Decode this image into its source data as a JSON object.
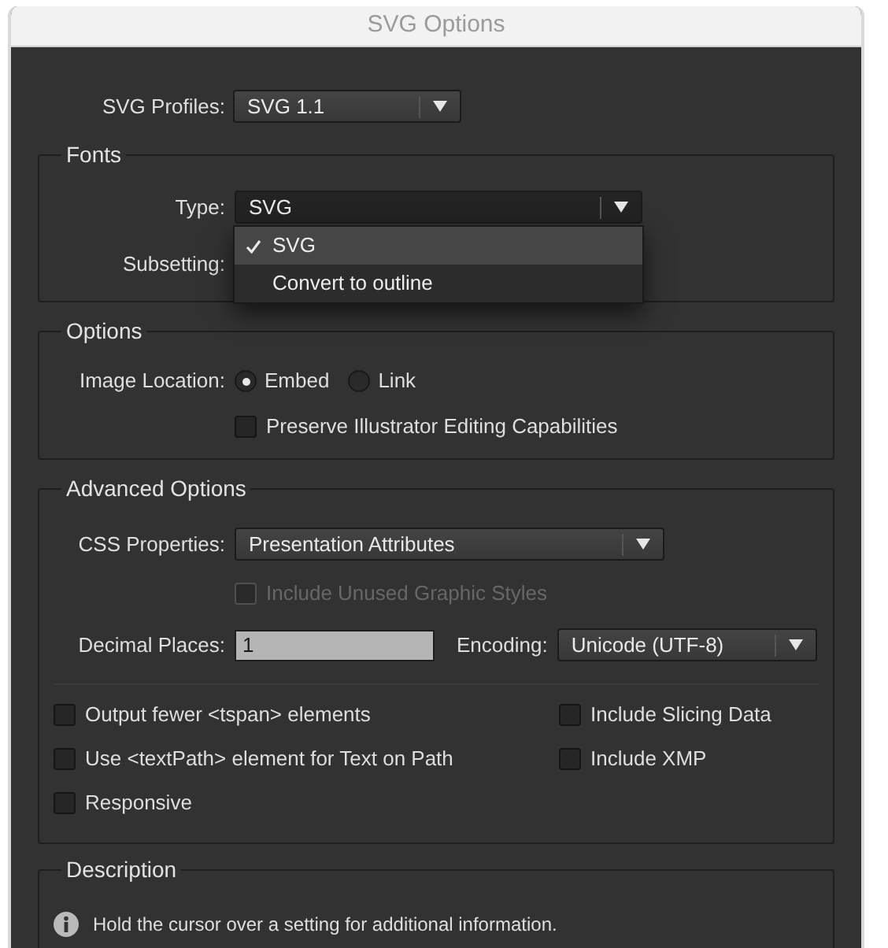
{
  "window": {
    "title": "SVG Options"
  },
  "svg_profiles": {
    "label": "SVG Profiles:",
    "value": "SVG 1.1"
  },
  "fonts": {
    "legend": "Fonts",
    "type": {
      "label": "Type:",
      "value": "SVG",
      "expanded": true,
      "menu": [
        {
          "label": "SVG",
          "selected": true
        },
        {
          "label": "Convert to outline",
          "selected": false
        }
      ]
    },
    "subsetting": {
      "label": "Subsetting:"
    }
  },
  "options": {
    "legend": "Options",
    "image_location": {
      "label": "Image Location:",
      "choices": [
        {
          "label": "Embed",
          "selected": true
        },
        {
          "label": "Link",
          "selected": false
        }
      ]
    },
    "preserve": {
      "label": "Preserve Illustrator Editing Capabilities",
      "checked": false,
      "disabled": false
    }
  },
  "advanced": {
    "legend": "Advanced Options",
    "css_properties": {
      "label": "CSS Properties:",
      "value": "Presentation Attributes"
    },
    "unused_styles": {
      "label": "Include Unused Graphic Styles",
      "checked": false,
      "disabled": true
    },
    "decimal_places": {
      "label": "Decimal Places:",
      "value": "1"
    },
    "encoding": {
      "label": "Encoding:",
      "value": "Unicode (UTF-8)"
    },
    "left_checkboxes": [
      {
        "label": "Output fewer <tspan> elements",
        "checked": false,
        "disabled": false
      },
      {
        "label": "Use <textPath> element for Text on Path",
        "checked": false,
        "disabled": false
      },
      {
        "label": "Responsive",
        "checked": false,
        "disabled": false
      }
    ],
    "right_checkboxes": [
      {
        "label": "Include Slicing Data",
        "checked": false,
        "disabled": false
      },
      {
        "label": "Include XMP",
        "checked": false,
        "disabled": false
      }
    ]
  },
  "description": {
    "legend": "Description",
    "text": "Hold the cursor over a setting for additional information."
  }
}
